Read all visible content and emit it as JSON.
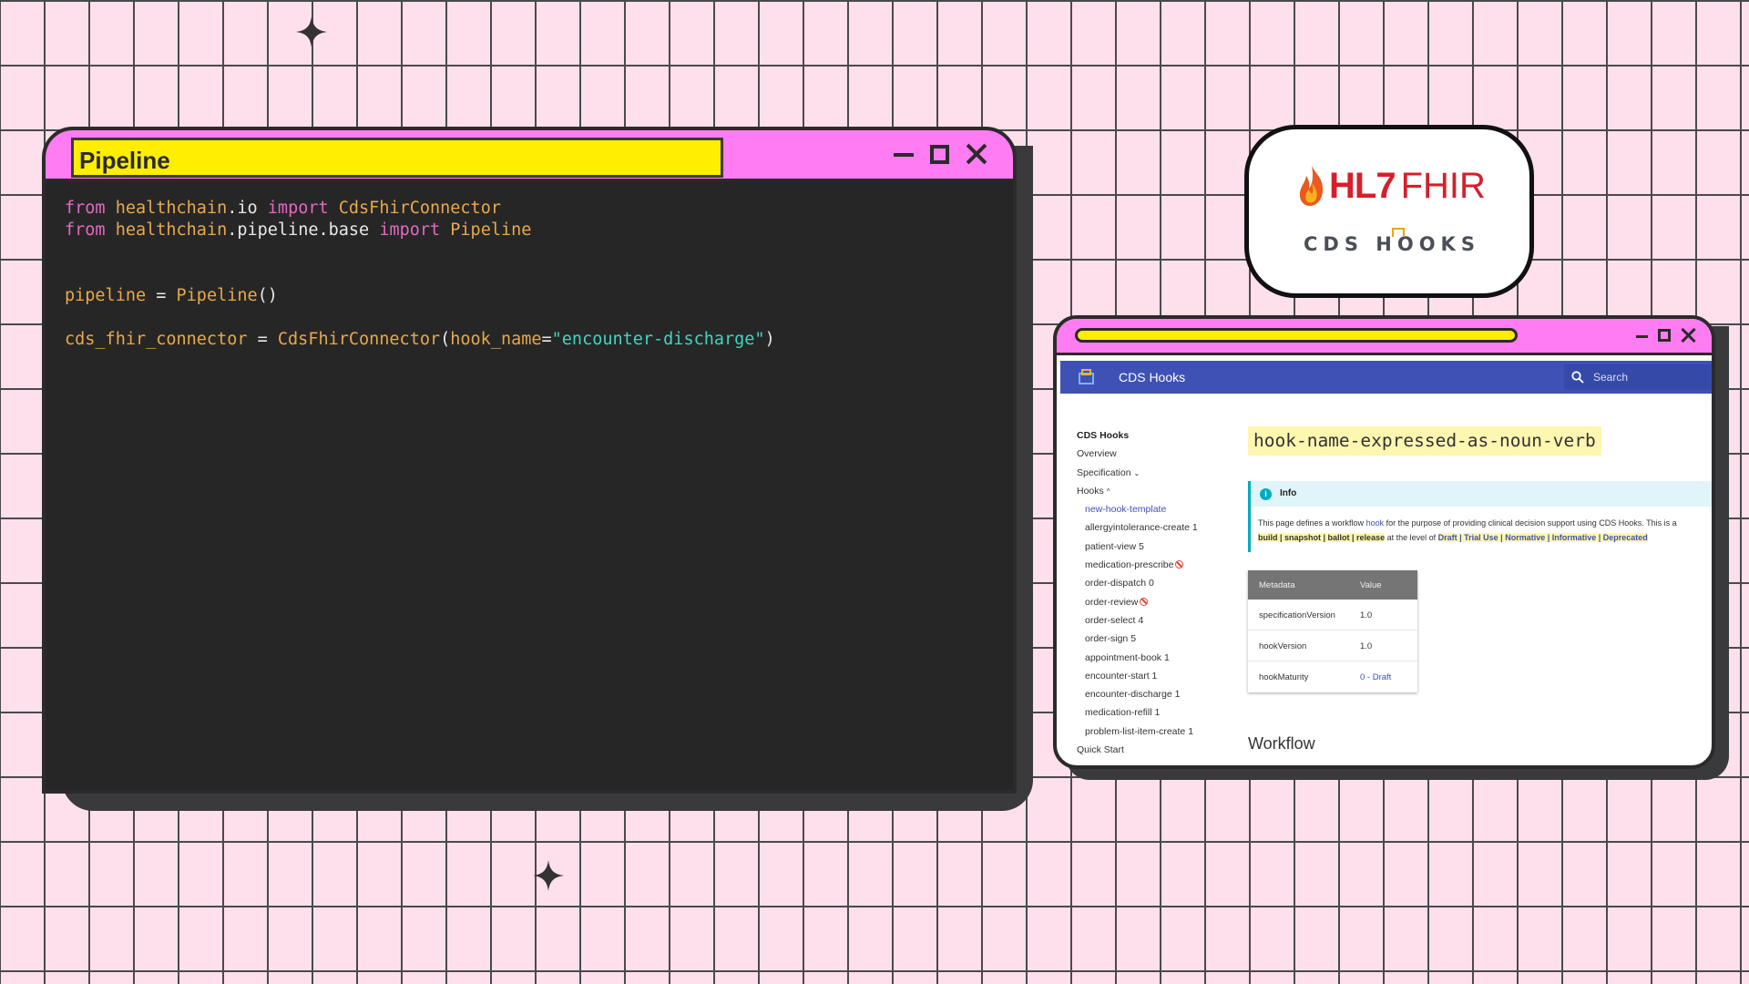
{
  "code_window": {
    "title": "Pipeline",
    "lines": [
      [
        {
          "t": "from",
          "c": "kw"
        },
        {
          "t": " ",
          "c": "txt"
        },
        {
          "t": "healthchain",
          "c": "mod"
        },
        {
          "t": ".io ",
          "c": "txt"
        },
        {
          "t": "import",
          "c": "kw"
        },
        {
          "t": " ",
          "c": "txt"
        },
        {
          "t": "CdsFhirConnector",
          "c": "cls"
        }
      ],
      [
        {
          "t": "from",
          "c": "kw"
        },
        {
          "t": " ",
          "c": "txt"
        },
        {
          "t": "healthchain",
          "c": "mod"
        },
        {
          "t": ".pipeline.base ",
          "c": "txt"
        },
        {
          "t": "import",
          "c": "kw"
        },
        {
          "t": " ",
          "c": "txt"
        },
        {
          "t": "Pipeline",
          "c": "cls"
        }
      ],
      [],
      [],
      [
        {
          "t": "pipeline",
          "c": "mod"
        },
        {
          "t": " = ",
          "c": "txt"
        },
        {
          "t": "Pipeline",
          "c": "cls"
        },
        {
          "t": "()",
          "c": "txt"
        }
      ],
      [],
      [
        {
          "t": "cds_fhir_connector",
          "c": "mod"
        },
        {
          "t": " = ",
          "c": "txt"
        },
        {
          "t": "CdsFhirConnector",
          "c": "cls"
        },
        {
          "t": "(",
          "c": "txt"
        },
        {
          "t": "hook_name",
          "c": "mod"
        },
        {
          "t": "=",
          "c": "txt"
        },
        {
          "t": "\"encounter-discharge\"",
          "c": "str"
        },
        {
          "t": ")",
          "c": "txt"
        }
      ]
    ]
  },
  "logo": {
    "hl7": "HL7",
    "fhir": "FHIR",
    "cds_hooks": "CDS HOOKS"
  },
  "browser": {
    "app_title": "CDS Hooks",
    "search_placeholder": "Search",
    "sidebar": [
      {
        "label": "CDS Hooks",
        "kind": "head"
      },
      {
        "label": "Overview",
        "kind": "top"
      },
      {
        "label": "Specification",
        "kind": "top",
        "chev": "⌄"
      },
      {
        "label": "Hooks",
        "kind": "top",
        "chev": "^"
      },
      {
        "label": "new-hook-template",
        "kind": "sub",
        "active": true
      },
      {
        "label": "allergyintolerance-create 1",
        "kind": "sub"
      },
      {
        "label": "patient-view 5",
        "kind": "sub"
      },
      {
        "label": "medication-prescribe",
        "kind": "sub",
        "blocked": true
      },
      {
        "label": "order-dispatch 0",
        "kind": "sub"
      },
      {
        "label": "order-review",
        "kind": "sub",
        "blocked": true
      },
      {
        "label": "order-select 4",
        "kind": "sub"
      },
      {
        "label": "order-sign 5",
        "kind": "sub"
      },
      {
        "label": "appointment-book 1",
        "kind": "sub"
      },
      {
        "label": "encounter-start 1",
        "kind": "sub"
      },
      {
        "label": "encounter-discharge 1",
        "kind": "sub"
      },
      {
        "label": "medication-refill 1",
        "kind": "sub"
      },
      {
        "label": "problem-list-item-create 1",
        "kind": "sub"
      },
      {
        "label": "Quick Start",
        "kind": "top"
      }
    ],
    "page_heading": "hook-name-expressed-as-noun-verb",
    "info": {
      "title": "Info",
      "text_1": "This page defines a workflow ",
      "text_link": "hook",
      "text_2": " for the purpose of providing clinical decision support using CDS Hooks. This is a",
      "stages": "build | snapshot | ballot | release",
      "level_text": " at the level of ",
      "levels": "Draft | Trial Use | Normative | Informative | Deprecated"
    },
    "metadata": {
      "headers": [
        "Metadata",
        "Value"
      ],
      "rows": [
        [
          "specificationVersion",
          "1.0"
        ],
        [
          "hookVersion",
          "1.0"
        ],
        [
          "hookMaturity",
          "0 - Draft"
        ]
      ]
    },
    "workflow_heading": "Workflow"
  },
  "colors": {
    "background": "#fde0ec",
    "titlebar": "#ff7cf2",
    "highlight": "#ffee00",
    "editor_bg": "#262627",
    "app_bar": "#3f51b5"
  }
}
